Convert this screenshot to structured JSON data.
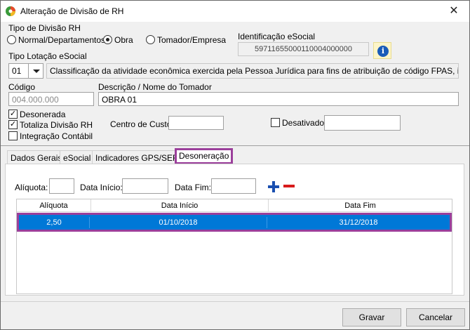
{
  "window": {
    "title": "Alteração de Divisão de RH"
  },
  "tipo_divisao": {
    "label": "Tipo de Divisão RH",
    "options": [
      "Normal/Departamentos",
      "Obra",
      "Tomador/Empresa"
    ],
    "selected": "Obra"
  },
  "identificacao": {
    "label": "Identificação eSocial",
    "value": "59711655000110004000000"
  },
  "tipo_lotacao": {
    "label": "Tipo Lotação eSocial",
    "code": "01",
    "description": "Classificação da atividade econômica exercida pela Pessoa Jurídica para fins de atribuição de código FPAS, inclusive obras"
  },
  "codigo": {
    "label": "Código",
    "value": "004.000.000"
  },
  "descricao": {
    "label": "Descrição / Nome do Tomador",
    "value": "OBRA 01"
  },
  "checks": {
    "desonerada": {
      "label": "Desonerada",
      "checked": true
    },
    "totaliza": {
      "label": "Totaliza Divisão RH",
      "checked": true
    },
    "integracao": {
      "label": "Integração Contábil",
      "checked": false
    },
    "desativado": {
      "label": "Desativado",
      "checked": false
    }
  },
  "centro_custo": {
    "label": "Centro de Custo",
    "value": ""
  },
  "tabs": [
    "Dados Gerais",
    "eSocial",
    "Indicadores GPS/SEFIP",
    "Desoneração"
  ],
  "active_tab": "Desoneração",
  "deson_form": {
    "aliquota_label": "Alíquota:",
    "data_inicio_label": "Data Início:",
    "data_fim_label": "Data Fim:"
  },
  "grid": {
    "columns": [
      "Alíquota",
      "Data Início",
      "Data Fim"
    ],
    "rows": [
      {
        "aliquota": "2,50",
        "data_inicio": "01/10/2018",
        "data_fim": "31/12/2018"
      }
    ]
  },
  "buttons": {
    "gravar": "Gravar",
    "cancelar": "Cancelar"
  },
  "colors": {
    "selection": "#0078d7",
    "highlight": "#9b3f9b",
    "plus": "#1a4fb0",
    "minus": "#d81b1b"
  }
}
